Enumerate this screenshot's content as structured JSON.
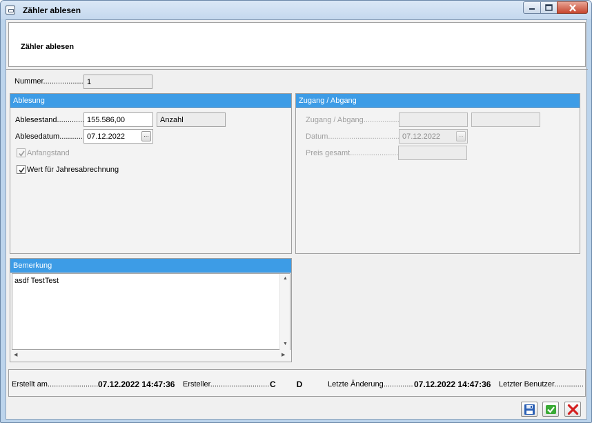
{
  "window": {
    "title": "Zähler ablesen"
  },
  "header": {
    "title": "Zähler ablesen"
  },
  "form": {
    "nummer_label": "Nummer....................",
    "nummer_value": "1"
  },
  "ablesung": {
    "title": "Ablesung",
    "ablesestand_label": "Ablesestand.............",
    "ablesestand_value": "155.586,00",
    "einheit": "Anzahl",
    "ablesedatum_label": "Ablesedatum..............",
    "ablesedatum_value": "07.12.2022",
    "anfangstand_label": "Anfangstand",
    "anfangstand_checked": true,
    "jahresabrechnung_label": "Wert für Jahresabrechnung",
    "jahresabrechnung_checked": true
  },
  "zugang": {
    "title": "Zugang / Abgang",
    "zugang_label": "Zugang / Abgang.................",
    "zugang_value": "",
    "zugang_value2": "",
    "datum_label": "Datum.....................................",
    "datum_value": "07.12.2022",
    "preis_label": "Preis gesamt..........................",
    "preis_value": ""
  },
  "bemerkung": {
    "title": "Bemerkung",
    "text": "asdf TestTest"
  },
  "footer": {
    "erstellt_label": "Erstellt am.........................",
    "erstellt_value": "07.12.2022 14:47:36",
    "ersteller_label": "Ersteller............................",
    "ersteller_value": "C         D",
    "aenderung_label": "Letzte Änderung..............",
    "aenderung_value": "07.12.2022 14:47:36",
    "benutzer_label": "Letzter Benutzer.............."
  },
  "colors": {
    "group_header": "#3d9ce6",
    "window_frame": "#bcd4ec",
    "save_icon": "#2a5fb4",
    "ok_icon": "#3aaa35",
    "cancel_icon": "#d42020"
  },
  "icons": {
    "window": "window-icon",
    "minimize": "minimize-icon",
    "maximize": "maximize-icon",
    "close": "close-icon",
    "calendar": "calendar-ellipsis-icon",
    "save": "floppy-disk-icon",
    "ok": "checkmark-icon",
    "cancel": "red-x-icon"
  }
}
